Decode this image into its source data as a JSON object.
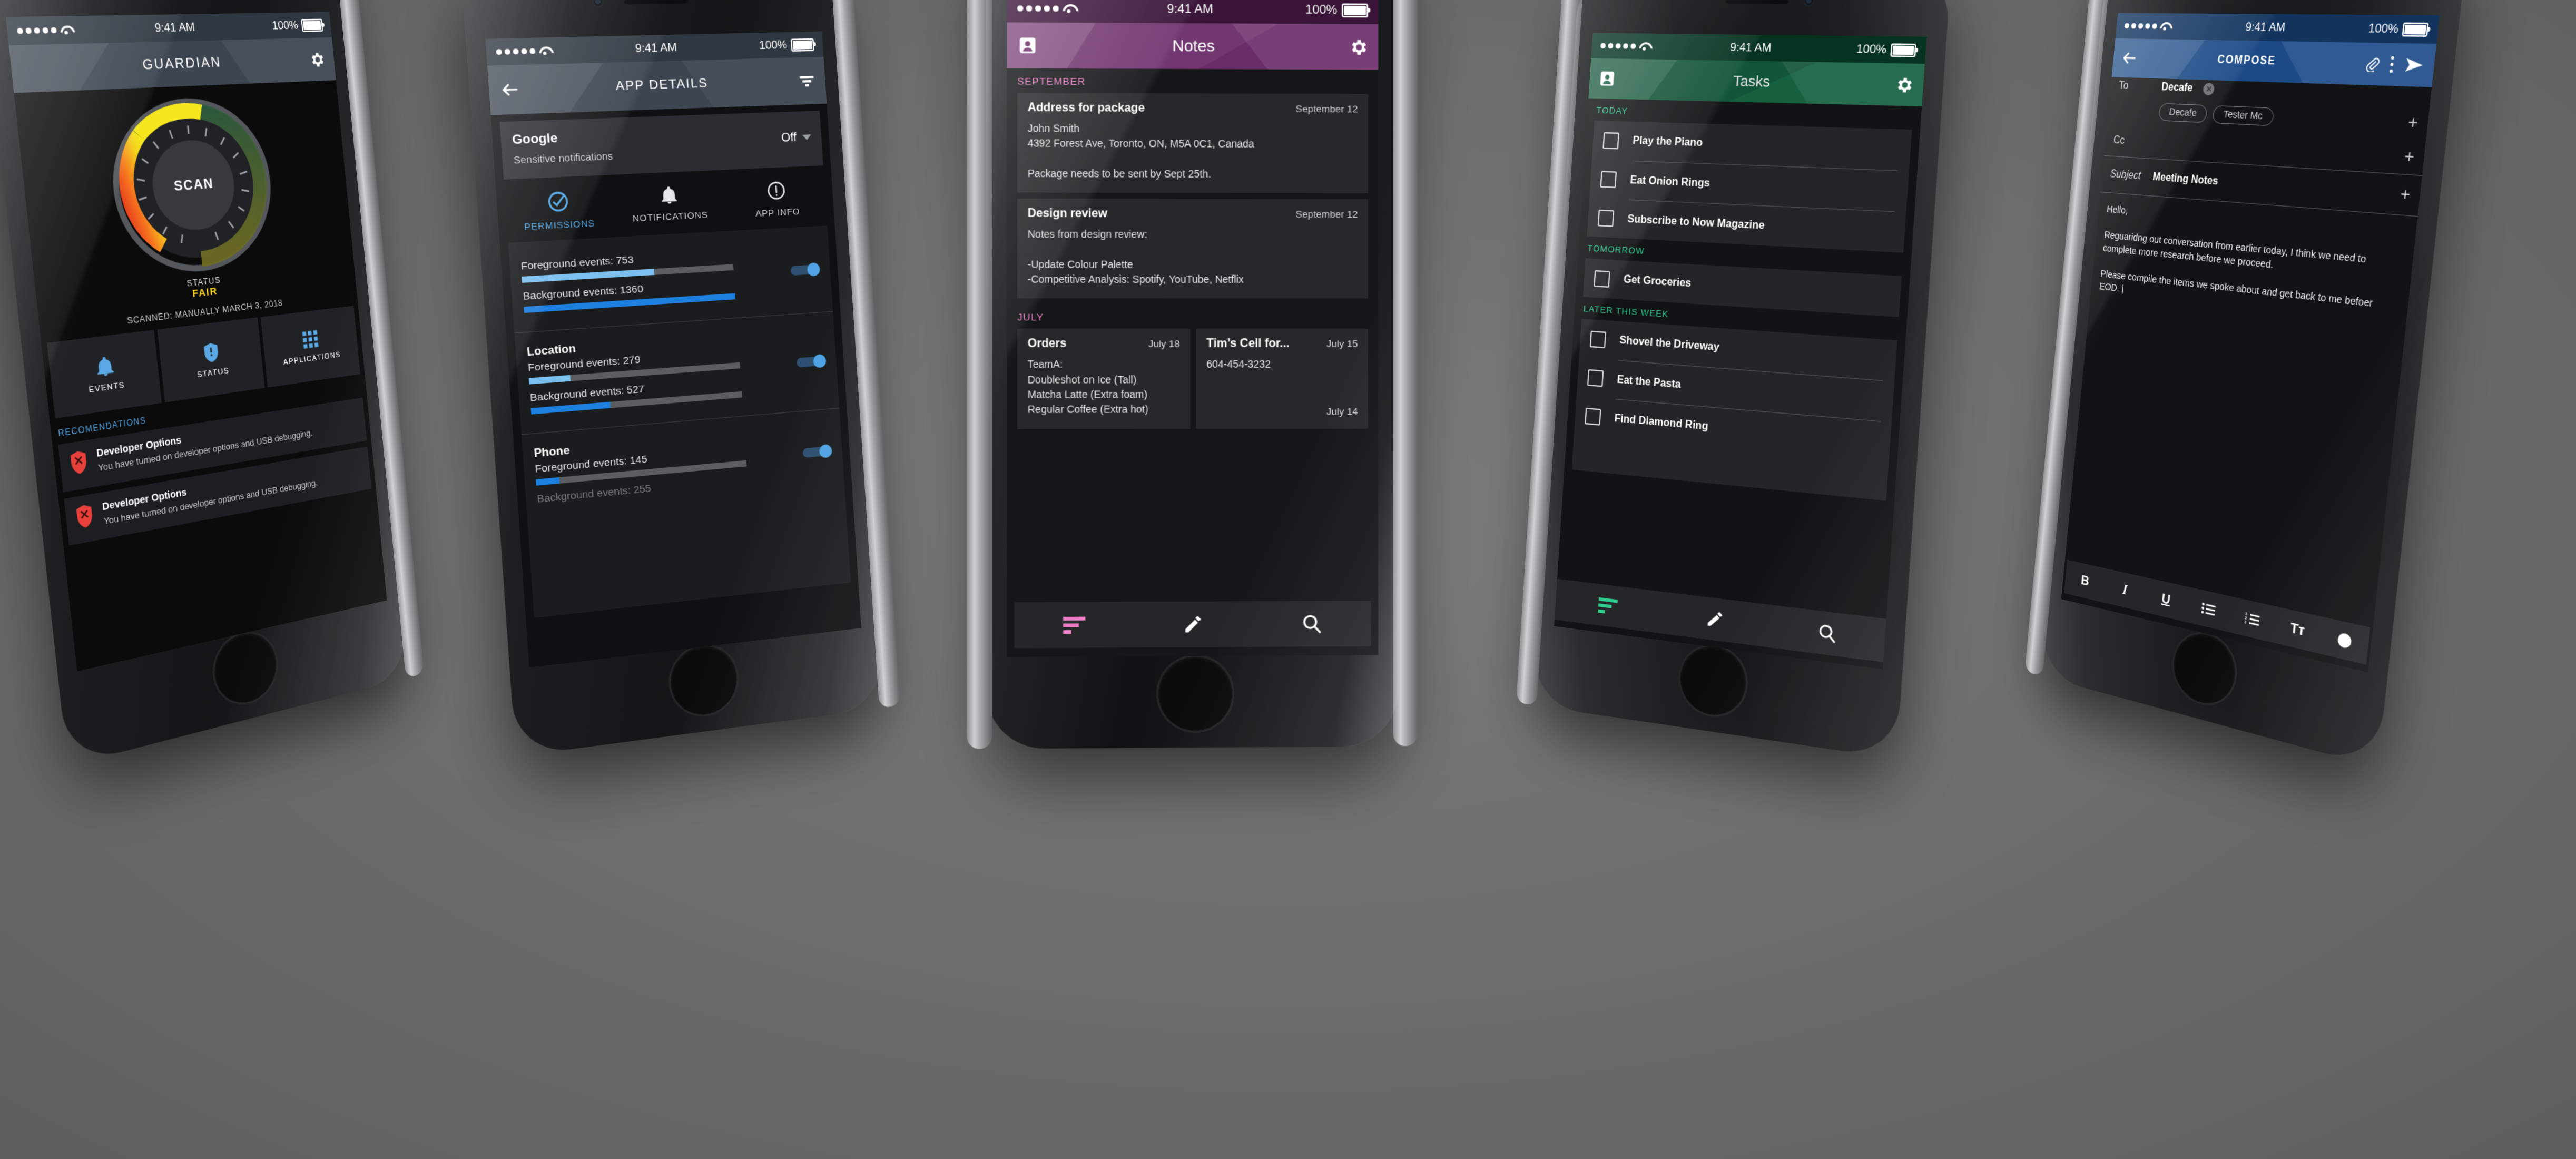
{
  "background_color": "#6e6e6e",
  "shared": {
    "time": "9:41 AM",
    "battery": "100%"
  },
  "phone1": {
    "app_name": "GUARDIAN",
    "settings_icon": "gear-icon",
    "gauge": {
      "center_label": "SCAN",
      "status_label": "STATUS",
      "status_value": "FAIR",
      "status_color": "#f5d01e",
      "arc_colors": [
        "#e02a1f",
        "#f5a11e",
        "#f5e01e",
        "#3f7d4a"
      ]
    },
    "scanned_text": "SCANNED: MANUALLY MARCH 3, 2018",
    "tiles": [
      {
        "label": "EVENTS",
        "icon": "bell-icon"
      },
      {
        "label": "STATUS",
        "icon": "shield-alert-icon"
      },
      {
        "label": "APPLICATIONS",
        "icon": "grid-icon"
      }
    ],
    "recommendations_header": "RECOMENDATIONS",
    "accent": "#4fa3e3",
    "recommendations": [
      {
        "icon": "shield-x-icon",
        "title": "Developer Options",
        "desc": "You have turned on developer options and USB debugging."
      },
      {
        "icon": "shield-x-icon",
        "title": "Developer Options",
        "desc": "You have turned on developer options and USB debugging."
      }
    ]
  },
  "phone2": {
    "title": "APP DETAILS",
    "back_icon": "arrow-left-icon",
    "filter_icon": "filter-icon",
    "app": {
      "name": "Google",
      "subtitle": "Sensitive notifications",
      "state": "Off"
    },
    "tabs": [
      {
        "label": "PERMISSIONS",
        "icon": "check-circle-icon",
        "active": true
      },
      {
        "label": "NOTIFICATIONS",
        "icon": "bell-icon",
        "active": false
      },
      {
        "label": "APP INFO",
        "icon": "info-circle-icon",
        "active": false
      }
    ],
    "accent": "#4fa3e3",
    "permissions": [
      {
        "name": "",
        "fg_label": "Foreground events: 753",
        "fg_pct": 62,
        "bg_label": "Background events: 1360",
        "bg_pct": 100,
        "enabled": true,
        "dim": false
      },
      {
        "name": "Location",
        "fg_label": "Foreground events: 279",
        "fg_pct": 19,
        "bg_label": "Background events: 527",
        "bg_pct": 37,
        "enabled": true,
        "dim": false
      },
      {
        "name": "Phone",
        "fg_label": "Foreground events: 145",
        "fg_pct": 11,
        "bg_label": "Background events: 255",
        "bg_pct": 18,
        "enabled": true,
        "dim": true
      }
    ]
  },
  "phone3": {
    "title": "Notes",
    "profile_icon": "contact-card-icon",
    "settings_icon": "gear-icon",
    "accent": "#f07ec8",
    "sections": [
      {
        "header": "SEPTEMBER",
        "notes": [
          {
            "title": "Address for package",
            "date": "September 12",
            "body": "John Smith\n4392 Forest Ave, Toronto, ON, M5A 0C1, Canada\n\nPackage needs to be sent by Sept 25th."
          },
          {
            "title": "Design review",
            "date": "September 12",
            "body": "Notes from design review:\n\n-Update Colour Palette\n-Competitive Analysis: Spotify, YouTube, Netflix"
          }
        ]
      },
      {
        "header": "JULY",
        "grid": [
          {
            "title": "Orders",
            "date": "July 18",
            "body": "TeamA:\nDoubleshot on Ice (Tall)\nMatcha Latte (Extra foam)\nRegular Coffee (Extra hot)"
          },
          {
            "title": "Tim’s Cell for...",
            "date": "July 15",
            "body": "604-454-3232",
            "footer_date": "July 14"
          }
        ]
      }
    ],
    "toolbar": [
      {
        "icon": "sort-icon",
        "name": "sort-button"
      },
      {
        "icon": "pencil-icon",
        "name": "compose-button"
      },
      {
        "icon": "search-icon",
        "name": "search-button"
      }
    ]
  },
  "phone4": {
    "title": "Tasks",
    "profile_icon": "contact-card-icon",
    "settings_icon": "gear-icon",
    "accent": "#2ecc8f",
    "sections": [
      {
        "header": "TODAY",
        "tasks": [
          "Play the Piano",
          "Eat Onion Rings",
          "Subscribe to Now Magazine"
        ]
      },
      {
        "header": "TOMORROW",
        "tasks": [
          "Get Groceries"
        ]
      },
      {
        "header": "LATER THIS WEEK",
        "tasks": [
          "Shovel the Driveway",
          "Eat the Pasta",
          "Find Diamond Ring"
        ]
      }
    ],
    "toolbar": [
      {
        "icon": "sort-icon",
        "name": "sort-button"
      },
      {
        "icon": "pencil-icon",
        "name": "compose-button"
      },
      {
        "icon": "search-icon",
        "name": "search-button"
      }
    ]
  },
  "phone5": {
    "title": "COMPOSE",
    "back_icon": "arrow-left-icon",
    "accent": "#1b4a86",
    "actions": [
      {
        "icon": "paperclip-icon",
        "name": "attach-button"
      },
      {
        "icon": "overflow-dots-icon",
        "name": "more-button"
      },
      {
        "icon": "send-icon",
        "name": "send-button"
      }
    ],
    "to": {
      "label": "To",
      "value": "Decafe",
      "suggestions": [
        "Decafe",
        "Tester Mc"
      ]
    },
    "cc": {
      "label": "Cc",
      "value": ""
    },
    "subject": {
      "label": "Subject",
      "value": "Meeting Notes"
    },
    "body": "Hello,\n\nReguaridng out conversation from earlier today, I think we need to complete more research before we proceed.\n\nPlease compile the items we spoke about and get back to me befoer EOD. |",
    "format_tools": [
      {
        "label": "B",
        "name": "bold-button"
      },
      {
        "label": "I",
        "name": "italic-button"
      },
      {
        "label": "U",
        "name": "underline-button"
      },
      {
        "label": "☰",
        "name": "bullet-list-button"
      },
      {
        "label": "≡",
        "name": "numbered-list-button"
      },
      {
        "label": "Tᴛ",
        "name": "text-size-button"
      },
      {
        "label": "●",
        "name": "text-color-button"
      }
    ]
  }
}
